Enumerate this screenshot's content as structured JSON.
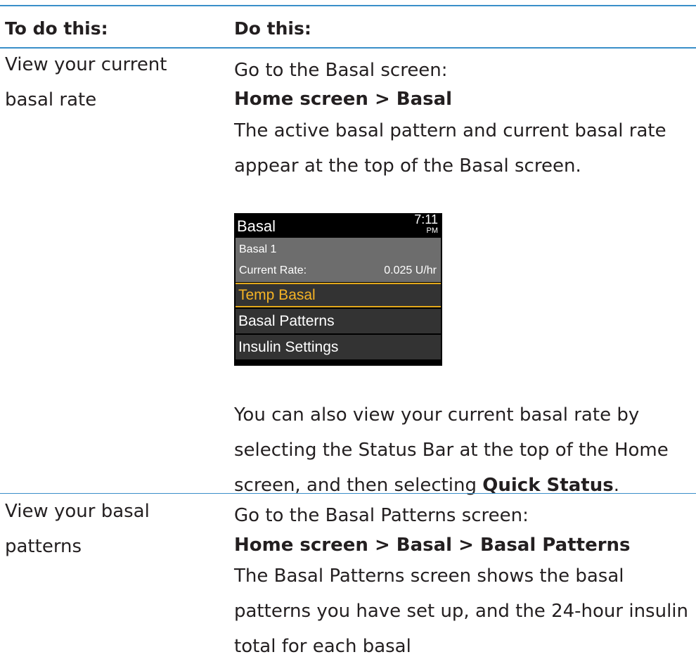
{
  "header": {
    "col1": "To do this:",
    "col2": "Do this:"
  },
  "rows": [
    {
      "task": "View your current basal rate",
      "intro": "Go to the Basal screen:",
      "path": "Home screen > Basal",
      "desc": "The active basal pattern and current basal rate appear at the top of the Basal screen.",
      "note_pre": "You can also view your current basal rate by selecting the Status Bar at the top of the Home screen, and then selecting ",
      "note_bold": "Quick Status",
      "note_post": "."
    },
    {
      "task": "View your basal patterns",
      "intro": "Go to the Basal Patterns screen:",
      "path": "Home screen > Basal > Basal Patterns",
      "desc": "The Basal Patterns screen shows the basal patterns you have set up, and the 24-hour insulin total for each basal"
    }
  ],
  "device": {
    "title": "Basal",
    "time": "7:11",
    "ampm": "PM",
    "pattern": "Basal 1",
    "rate_label": "Current Rate:",
    "rate_value": "0.025 U/hr",
    "menu": [
      "Temp Basal",
      "Basal Patterns",
      "Insulin Settings"
    ],
    "colors": {
      "selected_text": "#f5b325",
      "info_bg": "#6d6d6d",
      "menu_bg": "#333333",
      "rule": "#3a8fc9"
    }
  }
}
